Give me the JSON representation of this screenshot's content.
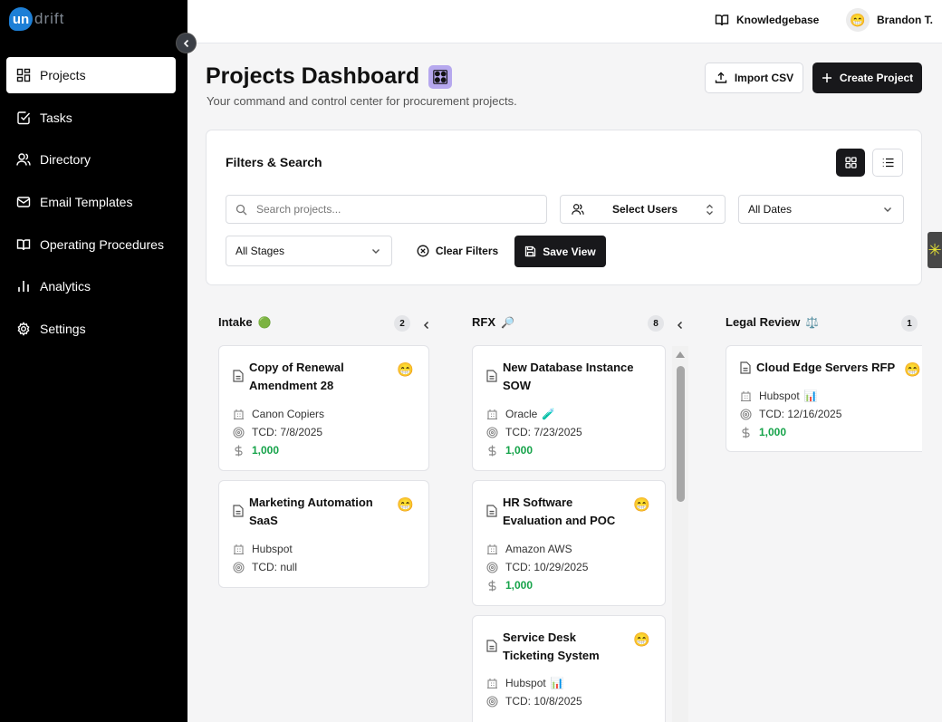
{
  "brand": {
    "logo_mark": "un",
    "logo_text": "drift"
  },
  "sidebar": {
    "items": [
      {
        "label": "Projects",
        "icon": "grid-icon",
        "active": true
      },
      {
        "label": "Tasks",
        "icon": "check-square-icon"
      },
      {
        "label": "Directory",
        "icon": "users-icon"
      },
      {
        "label": "Email Templates",
        "icon": "mail-icon"
      },
      {
        "label": "Operating Procedures",
        "icon": "book-open-icon"
      },
      {
        "label": "Analytics",
        "icon": "bar-chart-icon"
      },
      {
        "label": "Settings",
        "icon": "gear-icon"
      }
    ]
  },
  "topbar": {
    "knowledgebase": "Knowledgebase",
    "user_name": "Brandon T.",
    "user_avatar": "😁"
  },
  "header": {
    "title": "Projects Dashboard",
    "title_emoji": "🎛",
    "subtitle": "Your command and control center for procurement projects.",
    "import_label": "Import CSV",
    "create_label": "Create Project"
  },
  "filters": {
    "title": "Filters & Search",
    "search_placeholder": "Search projects...",
    "users_label": "Select Users",
    "dates_label": "All Dates",
    "stages_label": "All Stages",
    "clear_label": "Clear Filters",
    "save_label": "Save View"
  },
  "columns": [
    {
      "name": "Intake",
      "emoji": "🟢",
      "count": "2",
      "cards": [
        {
          "title": "Copy of Renewal Amendment 28",
          "emoji": "😁",
          "vendor": "Canon Copiers",
          "vendor_emoji": "",
          "tcd": "TCD: 7/8/2025",
          "amount": "1,000"
        },
        {
          "title": "Marketing Automation SaaS",
          "emoji": "😁",
          "vendor": "Hubspot",
          "vendor_emoji": "",
          "tcd": "TCD: null",
          "amount": ""
        }
      ]
    },
    {
      "name": "RFX",
      "emoji": "🔎",
      "count": "8",
      "cards": [
        {
          "title": "New Database Instance SOW",
          "emoji": "",
          "vendor": "Oracle",
          "vendor_emoji": "🧪",
          "tcd": "TCD: 7/23/2025",
          "amount": "1,000"
        },
        {
          "title": "HR Software Evaluation and POC",
          "emoji": "😁",
          "vendor": "Amazon AWS",
          "vendor_emoji": "",
          "tcd": "TCD: 10/29/2025",
          "amount": "1,000"
        },
        {
          "title": "Service Desk Ticketing System",
          "emoji": "😁",
          "vendor": "Hubspot",
          "vendor_emoji": "📊",
          "tcd": "TCD: 10/8/2025",
          "amount": ""
        }
      ]
    },
    {
      "name": "Legal Review",
      "emoji": "⚖️",
      "count": "1",
      "cards": [
        {
          "title": "Cloud Edge Servers RFP",
          "emoji": "😁",
          "vendor": "Hubspot",
          "vendor_emoji": "📊",
          "tcd": "TCD: 12/16/2025",
          "amount": "1,000"
        }
      ]
    }
  ],
  "colors": {
    "sidebar_bg": "#000000",
    "primary_button": "#18181b",
    "amount_green": "#16a34a",
    "logo_blue": "#1d7fd6"
  }
}
